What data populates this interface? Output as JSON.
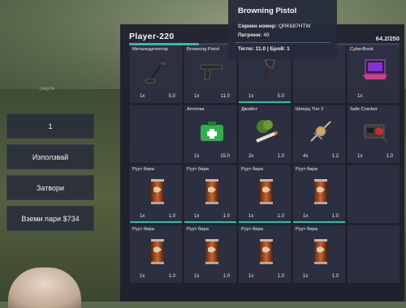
{
  "player": {
    "name": "Player-220",
    "weight": "64.2/250",
    "weight_fraction": 0.257
  },
  "menu": {
    "quantity": "1",
    "use_label": "Използвай",
    "close_label": "Затвори",
    "take_money_label": "Вземи пари $734"
  },
  "background_label": "Закупи",
  "tooltip": {
    "title": "Browning Pistol",
    "serial_label": "Сериен номер:",
    "serial_value": "QRK687HTW",
    "ammo_label": "Патрони:",
    "ammo_value": "49",
    "footer": "Тегло: 11.0 | Брой: 1"
  },
  "slots": [
    {
      "name": "Металодетектор",
      "count": "1x",
      "weight": "5.0",
      "icon": "metal-detector-icon",
      "bar": false
    },
    {
      "name": "Browning Pistol",
      "count": "1x",
      "weight": "11.0",
      "icon": "pistol-icon",
      "bar": false
    },
    {
      "name": "",
      "count": "1x",
      "weight": "5.0",
      "icon": "axe-icon",
      "bar": true
    },
    {
      "name": "",
      "count": "",
      "weight": "",
      "icon": "",
      "bar": false
    },
    {
      "name": "CyberBook",
      "count": "1x",
      "weight": "",
      "icon": "laptop-icon",
      "bar": false
    },
    {
      "name": "",
      "count": "",
      "weight": "",
      "icon": "",
      "bar": false
    },
    {
      "name": "Аптечка",
      "count": "1x",
      "weight": "15.0",
      "icon": "medkit-icon",
      "bar": false
    },
    {
      "name": "Джойнт",
      "count": "2x",
      "weight": "1.0",
      "icon": "joint-icon",
      "bar": false
    },
    {
      "name": "Шперц Tier 2",
      "count": "4x",
      "weight": "1.2",
      "icon": "lockpick-icon",
      "bar": false
    },
    {
      "name": "Safe Cracker",
      "count": "1x",
      "weight": "1.0",
      "icon": "safe-cracker-icon",
      "bar": false
    },
    {
      "name": "Руут бира",
      "count": "1x",
      "weight": "1.0",
      "icon": "beer-can-icon",
      "bar": true
    },
    {
      "name": "Руут бира",
      "count": "1x",
      "weight": "1.0",
      "icon": "beer-can-icon",
      "bar": true
    },
    {
      "name": "Руут бира",
      "count": "1x",
      "weight": "1.0",
      "icon": "beer-can-icon",
      "bar": true
    },
    {
      "name": "Руут бира",
      "count": "1x",
      "weight": "1.0",
      "icon": "beer-can-icon",
      "bar": true
    },
    {
      "name": "",
      "count": "",
      "weight": "",
      "icon": "",
      "bar": false
    },
    {
      "name": "Руут бира",
      "count": "1x",
      "weight": "1.0",
      "icon": "beer-can-icon",
      "bar": false
    },
    {
      "name": "Руут бира",
      "count": "1x",
      "weight": "1.0",
      "icon": "beer-can-icon",
      "bar": false
    },
    {
      "name": "Руут бира",
      "count": "1x",
      "weight": "1.0",
      "icon": "beer-can-icon",
      "bar": false
    },
    {
      "name": "Руут бира",
      "count": "1x",
      "weight": "1.0",
      "icon": "beer-can-icon",
      "bar": false
    },
    {
      "name": "",
      "count": "",
      "weight": "",
      "icon": "",
      "bar": false
    }
  ],
  "colors": {
    "accent": "#23c4a6",
    "panel": "#1c1e2c",
    "slot": "#303446"
  }
}
